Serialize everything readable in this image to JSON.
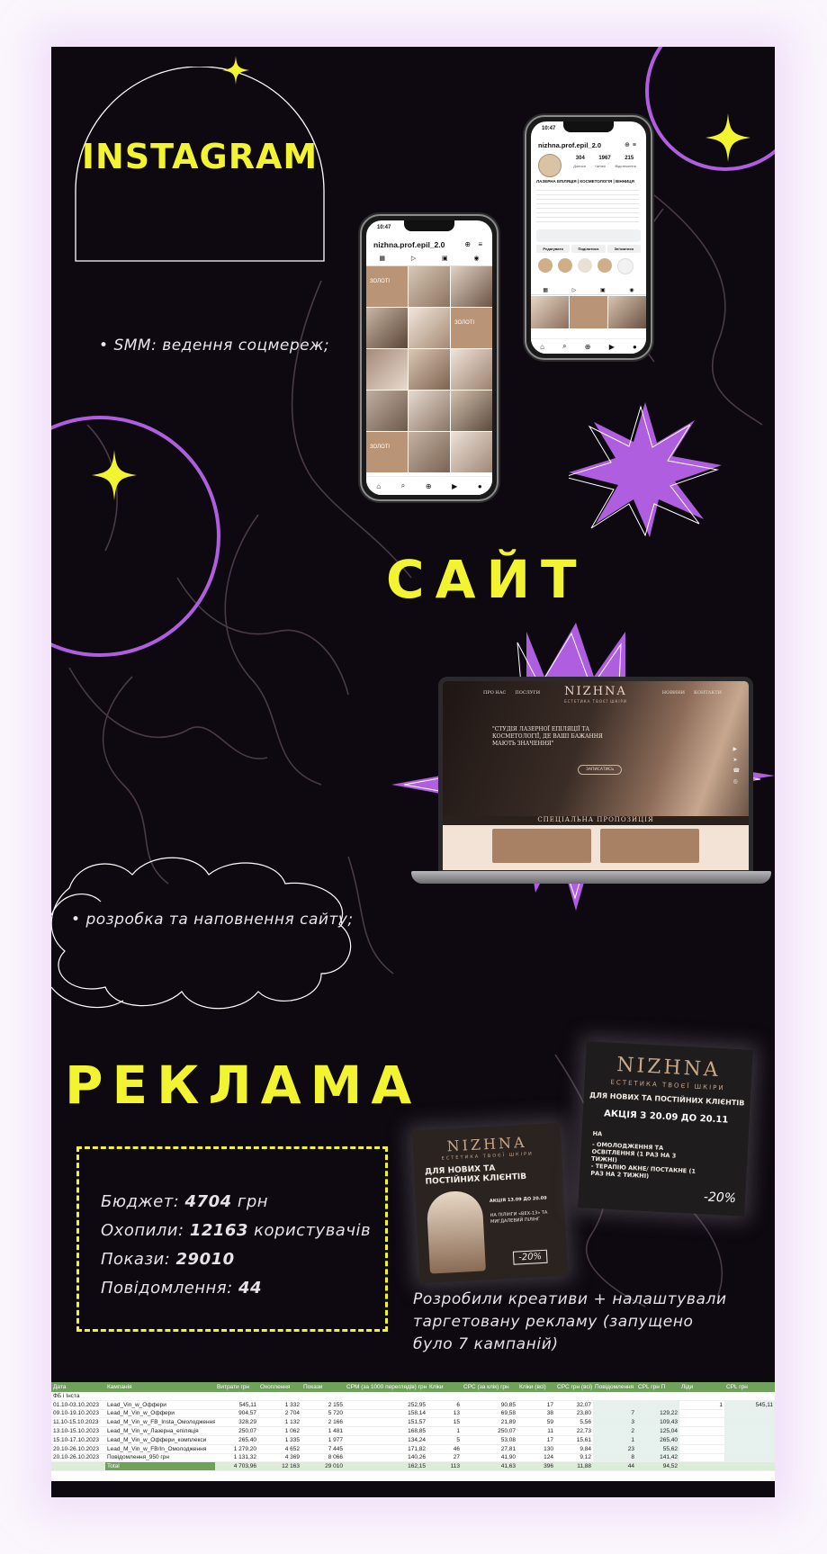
{
  "instagram": {
    "title": "INSTAGRAM",
    "bullet": "SMM: ведення соцмереж;",
    "phone_left": {
      "time": "10:47",
      "handle": "nizhna.prof.epil_2.0"
    },
    "phone_right": {
      "time": "10:47",
      "handle": "nizhna.prof.epil_2.0",
      "stats": [
        "304",
        "1967",
        "215"
      ],
      "stat_labels": [
        "Дописи",
        "Читачі",
        "Відстеження"
      ],
      "bio_title": "ЛАЗЕРНА ЕПІЛЯЦІЯ | КОСМЕТОЛОГІЯ | ВІННИЦЯ",
      "buttons": [
        "Редагувати",
        "Поділитися",
        "Зв'язатися"
      ]
    },
    "tile_text": "ЗОЛОТІ"
  },
  "site": {
    "title": "САЙТ",
    "bullet": "розробка та наповнення сайту;",
    "brand": "NIZHNA",
    "brand_sub": "ЕСТЕТИКА ТВОЄЇ ШКІРИ",
    "nav": [
      "ПРО НАС",
      "ПОСЛУГИ",
      "НОВИНИ",
      "КОНТАКТИ"
    ],
    "hero_quote": "\"СТУДІЯ ЛАЗЕРНОЇ ЕПІЛЯЦІЇ ТА КОСМЕТОЛОГІЇ, ДЕ ВАШІ БАЖАННЯ МАЮТЬ ЗНАЧЕННЯ\"",
    "hero_button": "ЗАПИСАТИСЬ",
    "special": "СПЕЦІАЛЬНА ПРОПОЗИЦІЯ"
  },
  "ads": {
    "title": "РЕКЛАМА",
    "stats": [
      {
        "label": "Бюджет:",
        "value": "4704",
        "unit": " грн"
      },
      {
        "label": "Охопили:",
        "value": "12163",
        "unit": " користувачів"
      },
      {
        "label": "Покази:",
        "value": "29010",
        "unit": ""
      },
      {
        "label": "Повідомлення:",
        "value": "44",
        "unit": ""
      }
    ],
    "description": "Розробили креативи + налаштували таргетовану рекламу (запущено було 7 кампаній)",
    "creative_small": {
      "brand": "NIZHNA",
      "sub": "ЕСТЕТИКА ТВОЄЇ ШКІРИ",
      "headline": "ДЛЯ НОВИХ ТА ПОСТІЙНИХ КЛІЄНТІВ",
      "promo": "АКЦІЯ 13.09 ДО 20.09",
      "offer": "НА ПІЛІНГИ «ВЕХ-13» ТА МИГДАЛЕВИЙ ПІЛІНГ",
      "discount": "-20%"
    },
    "creative_large": {
      "brand": "NIZHNA",
      "sub": "ЕСТЕТИКА ТВОЄЇ ШКІРИ",
      "headline": "ДЛЯ НОВИХ ТА ПОСТІЙНИХ КЛІЄНТІВ",
      "promo": "АКЦІЯ З 20.09 ДО 20.11",
      "on": "НА",
      "item1": "- ОМОЛОДЖЕННЯ ТА ОСВІТЛЕННЯ (1 РАЗ НА 3 ТИЖНІ)",
      "item2": "- ТЕРАПІЮ АКНЕ/ ПОСТАКНЕ (1 РАЗ НА 2 ТИЖНІ)",
      "discount": "-20%"
    }
  },
  "table": {
    "headers": [
      "Дата",
      "Кампанія",
      "Витрати грн",
      "Охоплення",
      "Покази",
      "CPM (за 1000 переглядів) грн",
      "Кліки",
      "CPC (за клік) грн",
      "Кліки (всі)",
      "CPC грн (всі)",
      "Повідомлення",
      "CPL грн П",
      "Ліди",
      "CPL грн"
    ],
    "group_label": "ФБ і Інста",
    "rows": [
      [
        "01.10-03.10.2023",
        "Lead_Vin_w_Оффери",
        "545,11",
        "1 332",
        "2 155",
        "252,95",
        "6",
        "90,85",
        "17",
        "32,07",
        "",
        "",
        "1",
        "545,11"
      ],
      [
        "09.10-19.10.2023",
        "Lead_M_Vin_w_Оффери",
        "904,57",
        "2 704",
        "5 720",
        "158,14",
        "13",
        "69,58",
        "38",
        "23,80",
        "7",
        "129,22",
        "",
        ""
      ],
      [
        "11.10-15.10.2023",
        "Lead_M_Vin_w_FB_Insta_Омолодження",
        "328,29",
        "1 132",
        "2 166",
        "151,57",
        "15",
        "21,89",
        "59",
        "5,56",
        "3",
        "109,43",
        "",
        ""
      ],
      [
        "13.10-15.10.2023",
        "Lead_M_Vin_w_Лазерна_епіляція",
        "250,07",
        "1 062",
        "1 481",
        "168,85",
        "1",
        "250,07",
        "11",
        "22,73",
        "2",
        "125,04",
        "",
        ""
      ],
      [
        "15.10-17.10.2023",
        "Lead_M_Vin_w_Оффери_комплекси",
        "265,40",
        "1 335",
        "1 977",
        "134,24",
        "5",
        "53,08",
        "17",
        "15,61",
        "1",
        "265,40",
        "",
        ""
      ],
      [
        "20.10-26.10.2023",
        "Lead_M_Vin_w_FB/In_Омолодження",
        "1 279,20",
        "4 652",
        "7 445",
        "171,82",
        "46",
        "27,81",
        "130",
        "9,84",
        "23",
        "55,62",
        "",
        ""
      ],
      [
        "20.10-26.10.2023",
        "Повідомлення_950 грн",
        "1 131,32",
        "4 369",
        "8 066",
        "140,26",
        "27",
        "41,90",
        "124",
        "9,12",
        "8",
        "141,42",
        "",
        ""
      ]
    ],
    "total": [
      "",
      "Total",
      "4 703,96",
      "12 163",
      "29 010",
      "162,15",
      "113",
      "41,63",
      "396",
      "11,88",
      "44",
      "94,52",
      "",
      ""
    ]
  },
  "colors": {
    "accent_yellow": "#f2f331",
    "violet": "#b05ee0",
    "background": "#0e0810",
    "table_header_green": "#6fa15a"
  }
}
